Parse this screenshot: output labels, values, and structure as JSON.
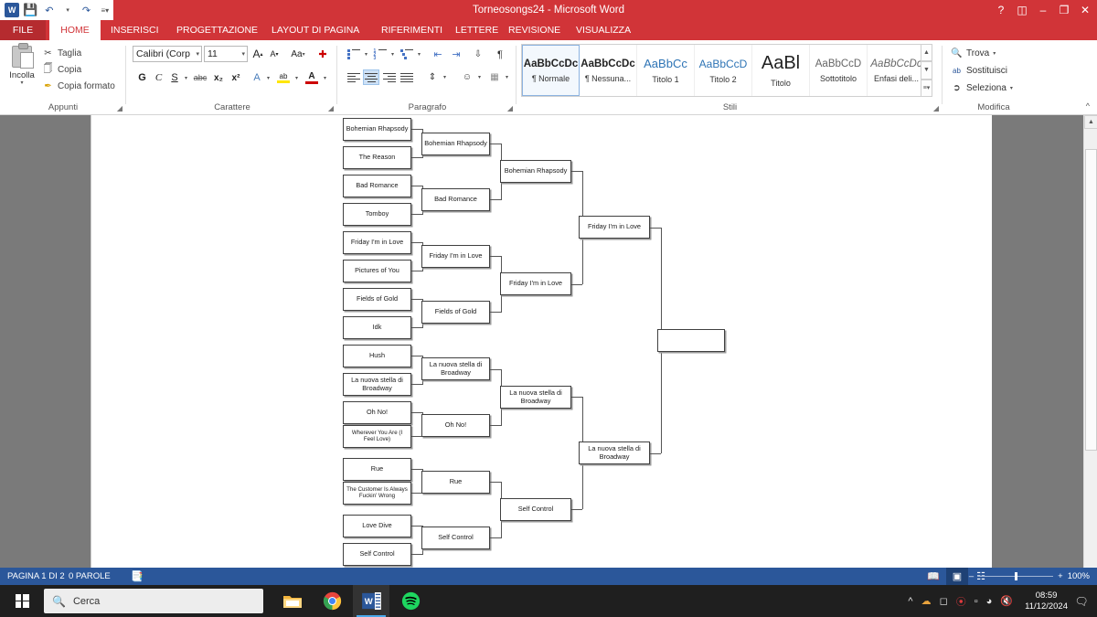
{
  "window": {
    "title": "Torneosongs24  -  Microsoft Word",
    "help_icon": "?",
    "ribbon_display_icon": "ribbon-display",
    "minimize_icon": "–",
    "restore_icon": "restore",
    "close_icon": "✕",
    "qat": {
      "app_icon": "W",
      "save_icon": "save",
      "undo_icon": "undo",
      "redo_icon": "redo",
      "customize_icon": "customize-qat"
    }
  },
  "tabs": {
    "file": "FILE",
    "items": [
      {
        "label": "HOME",
        "active": true
      },
      {
        "label": "INSERISCI",
        "active": false
      },
      {
        "label": "PROGETTAZIONE",
        "active": false
      },
      {
        "label": "LAYOUT DI PAGINA",
        "active": false
      },
      {
        "label": "RIFERIMENTI",
        "active": false
      },
      {
        "label": "LETTERE",
        "active": false
      },
      {
        "label": "REVISIONE",
        "active": false
      },
      {
        "label": "VISUALIZZA",
        "active": false
      }
    ]
  },
  "ribbon": {
    "appunti": {
      "label": "Appunti",
      "paste": "Incolla",
      "cut": "Taglia",
      "copy": "Copia",
      "format_painter": "Copia formato"
    },
    "carattere": {
      "label": "Carattere",
      "font_name": "Calibri (Corp",
      "font_size": "11",
      "grow_font": "A",
      "shrink_font": "A",
      "change_case": "Aa",
      "clear_formatting": "clear-formatting",
      "bold": "G",
      "italic": "C",
      "underline": "S",
      "strikethrough": "abc",
      "subscript": "x₂",
      "superscript": "x²",
      "text_effects": "A",
      "highlight": "ab",
      "font_color": "A"
    },
    "paragrafo": {
      "label": "Paragrafo",
      "bullets": "bullets",
      "numbering": "numbering",
      "multilevel": "multilevel-list",
      "decrease_indent": "decrease-indent",
      "increase_indent": "increase-indent",
      "sort": "sort",
      "show_marks": "¶",
      "align_left": "align-left",
      "align_center": "align-center",
      "align_right": "align-right",
      "justify": "justify",
      "line_spacing": "line-spacing",
      "shading": "shading",
      "borders": "borders"
    },
    "stili": {
      "label": "Stili",
      "gallery": [
        {
          "preview": "AaBbCcDc",
          "name": "¶ Normale",
          "selected": true
        },
        {
          "preview": "AaBbCcDc",
          "name": "¶ Nessuna...",
          "selected": false
        },
        {
          "preview": "AaBbCc",
          "name": "Titolo 1",
          "selected": false
        },
        {
          "preview": "AaBbCcD",
          "name": "Titolo 2",
          "selected": false
        },
        {
          "preview": "AaBl",
          "name": "Titolo",
          "selected": false
        },
        {
          "preview": "AaBbCcD",
          "name": "Sottotitolo",
          "selected": false
        },
        {
          "preview": "AaBbCcDc",
          "name": "Enfasi deli...",
          "selected": false
        }
      ],
      "scroll_up": "▲",
      "scroll_down": "▼",
      "more": "▾"
    },
    "modifica": {
      "label": "Modifica",
      "find": "Trova",
      "replace": "Sostituisci",
      "select": "Seleziona"
    },
    "collapse_icon": "^"
  },
  "bracket": {
    "round1": [
      "Bohemian Rhapsody",
      "The Reason",
      "Bad Romance",
      "Tomboy",
      "Friday I'm in Love",
      "Pictures of You",
      "Fields of Gold",
      "Idk",
      "Hush",
      "La nuova stella di Broadway",
      "Oh No!",
      "Wherever You Are (I Feel Love)",
      "Rue",
      "The Customer Is Always Fuckin' Wrong",
      "Love Dive",
      "Self Control"
    ],
    "round2": [
      "Bohemian Rhapsody",
      "Bad Romance",
      "Friday I'm in Love",
      "Fields of Gold",
      "La nuova stella di Broadway",
      "Oh No!",
      "Rue",
      "Self Control"
    ],
    "round3": [
      "Bohemian Rhapsody",
      "Friday I'm in Love",
      "La nuova stella di Broadway",
      "Self Control"
    ],
    "round4": [
      "Friday I'm in Love",
      "La nuova stella di Broadway"
    ],
    "final": [
      ""
    ]
  },
  "status": {
    "page": "PAGINA 1 DI 2",
    "words": "0 PAROLE",
    "proofing_icon": "proofing-errors",
    "view_read": "read-mode",
    "view_print": "print-layout",
    "view_web": "web-layout",
    "zoom_out": "–",
    "zoom_in": "+",
    "zoom_level": "100%"
  },
  "taskbar": {
    "start_icon": "windows-logo",
    "search_placeholder": "Cerca",
    "search_icon": "search-icon",
    "apps": [
      {
        "name": "file-explorer",
        "glyph": "file-explorer",
        "active": false
      },
      {
        "name": "google-chrome",
        "glyph": "chrome",
        "active": false
      },
      {
        "name": "microsoft-word",
        "glyph": "W",
        "active": true
      },
      {
        "name": "spotify",
        "glyph": "spotify",
        "active": false
      }
    ],
    "tray": [
      "show-hidden-icons",
      "onedrive-icon",
      "camera-icon",
      "adobe-icon",
      "battery-icon",
      "wifi-icon",
      "volume-muted-icon"
    ],
    "time": "08:59",
    "date": "11/12/2024",
    "notification_icon": "notifications"
  },
  "colors": {
    "word_red": "#d13438",
    "word_blue": "#2b579a",
    "accent": "#4472c4"
  }
}
